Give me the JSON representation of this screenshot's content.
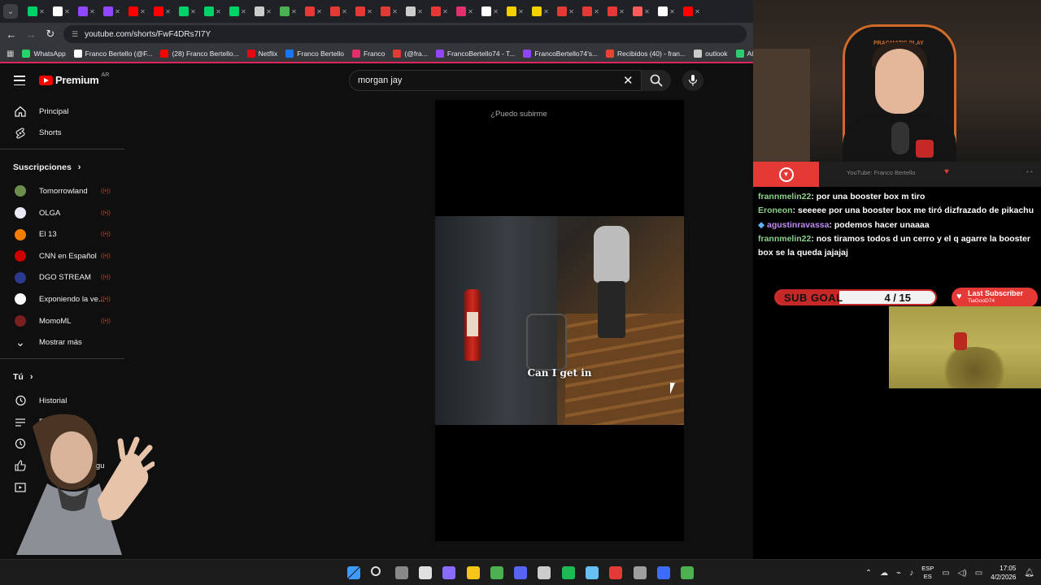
{
  "browser": {
    "url": "youtube.com/shorts/FwF4DRs7I7Y",
    "bookmarks": [
      {
        "label": "WhatsApp",
        "color": "#25d366"
      },
      {
        "label": "Franco Bertello (@F...",
        "color": "#ffffff"
      },
      {
        "label": "(28) Franco Bertello...",
        "color": "#ff0000"
      },
      {
        "label": "Netflix",
        "color": "#e50914"
      },
      {
        "label": "Franco Bertello",
        "color": "#1877f2"
      },
      {
        "label": "Franco",
        "color": "#e1306c"
      },
      {
        "label": "(@fra...",
        "color": "#e53935"
      },
      {
        "label": "FrancoBertello74 - T...",
        "color": "#9146ff"
      },
      {
        "label": "FrancoBertello74's...",
        "color": "#9146ff"
      },
      {
        "label": "Recibidos (40) - fran...",
        "color": "#ea4335"
      },
      {
        "label": "outlook",
        "color": "#cccccc"
      },
      {
        "label": "Aler",
        "color": "#2ecc71"
      }
    ],
    "tab_colors": [
      "#00d26a",
      "#ffffff",
      "#9146ff",
      "#9146ff",
      "#ff0000",
      "#ff0000",
      "#00d26a",
      "#00d26a",
      "#00d26a",
      "#cccccc",
      "#4caf50",
      "#e53935",
      "#e53935",
      "#e53935",
      "#e53935",
      "#cccccc",
      "#e53935",
      "#e1306c",
      "#ffffff",
      "#f5d000",
      "#f5d000",
      "#e53935",
      "#e53935",
      "#e53935",
      "#ff5a5a",
      "#ffffff",
      "#ff0000"
    ]
  },
  "youtube": {
    "logo": "Premium",
    "logo_country": "AR",
    "search_value": "morgan jay",
    "sidebar": {
      "main": [
        {
          "label": "Principal",
          "icon": "home-icon"
        },
        {
          "label": "Shorts",
          "icon": "shorts-icon"
        }
      ],
      "subs_title": "Suscripciones",
      "subs": [
        {
          "label": "Tomorrowland",
          "color": "#6b8e4e",
          "live": true
        },
        {
          "label": "OLGA",
          "color": "#e9e9f5",
          "live": true
        },
        {
          "label": "El 13",
          "color": "#f57c00",
          "live": true
        },
        {
          "label": "CNN en Español",
          "color": "#cc0000",
          "live": true
        },
        {
          "label": "DGO STREAM",
          "color": "#2b3a8f",
          "live": true
        },
        {
          "label": "Exponiendo la ve...",
          "color": "#ffffff",
          "live": true
        },
        {
          "label": "MomoML",
          "color": "#7a1f1f",
          "live": true
        },
        {
          "label": "Mostrar más",
          "color": "",
          "live": false
        }
      ],
      "you_title": "Tú",
      "you": [
        {
          "label": "Historial",
          "icon": "history-icon"
        },
        {
          "label": "P",
          "icon": "playlist-icon"
        },
        {
          "label": "",
          "icon": "watch-later-icon"
        },
        {
          "label": "e gu",
          "icon": "like-icon"
        },
        {
          "label": "",
          "icon": "your-videos-icon"
        }
      ]
    },
    "short": {
      "caption": "¿Puedo subirme",
      "subtitle": "Can I get in"
    }
  },
  "stream": {
    "chair_brand": "PRAGMATIC PLAY",
    "alert_source": "YouTube: Franco Bertello",
    "chat": [
      {
        "user": "frannmelin22",
        "text": ": por una booster box m tiro",
        "color": "green"
      },
      {
        "user": "Eroneon",
        "text": ": seeeee por una booster box me tiró dizfrazado de pikachu",
        "color": "green"
      },
      {
        "user": "agustinravassa",
        "text": ": podemos hacer unaaaa",
        "color": "purple"
      },
      {
        "user": "frannmelin22",
        "text": ": nos tiramos todos d un cerro y el q agarre la booster box se la queda jajajaj",
        "color": "green"
      }
    ],
    "subgoal": {
      "label": "SUB GOAL",
      "current": 4,
      "target": 15,
      "display": "4 / 15"
    },
    "last_subscriber": {
      "title": "Last Subscriber",
      "name": "TiaGooD74"
    }
  },
  "taskbar": {
    "icons": [
      {
        "name": "windows-start-icon",
        "color": "#3d9bff"
      },
      {
        "name": "search-icon",
        "color": "#dddddd"
      },
      {
        "name": "task-view-icon",
        "color": "#888888"
      },
      {
        "name": "store-icon",
        "color": "#e0e0e0"
      },
      {
        "name": "cortana-icon",
        "color": "#8a6bff"
      },
      {
        "name": "file-explorer-icon",
        "color": "#f5c518"
      },
      {
        "name": "chrome-icon",
        "color": "#4caf50"
      },
      {
        "name": "discord-icon",
        "color": "#5865f2"
      },
      {
        "name": "obs-icon",
        "color": "#cccccc"
      },
      {
        "name": "spotify-icon",
        "color": "#1db954"
      },
      {
        "name": "steam-icon",
        "color": "#66c0f4"
      },
      {
        "name": "app-icon",
        "color": "#e53935"
      },
      {
        "name": "app-icon-2",
        "color": "#9e9e9e"
      },
      {
        "name": "app-icon-3",
        "color": "#3d6bff"
      },
      {
        "name": "chrome-icon-2",
        "color": "#4caf50"
      }
    ],
    "lang_top": "ESP",
    "lang_bottom": "ES",
    "time": "17:05",
    "date": "4/2/2026"
  }
}
